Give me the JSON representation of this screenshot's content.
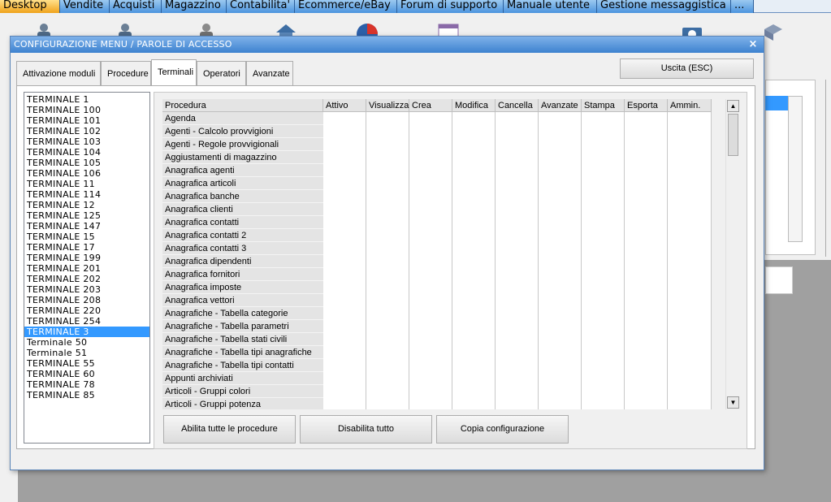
{
  "top_tabs": [
    {
      "label": "Desktop",
      "active": true
    },
    {
      "label": "Vendite"
    },
    {
      "label": "Acquisti"
    },
    {
      "label": "Magazzino"
    },
    {
      "label": "Contabilita'"
    },
    {
      "label": "Ecommerce/eBay"
    },
    {
      "label": "Forum di supporto"
    },
    {
      "label": "Manuale utente"
    },
    {
      "label": "Gestione messaggistica"
    },
    {
      "label": "..."
    }
  ],
  "dialog": {
    "title": "CONFIGURAZIONE MENU / PAROLE DI ACCESSO",
    "close_glyph": "×",
    "tabs": [
      "Attivazione moduli",
      "Procedure",
      "Terminali",
      "Operatori",
      "Avanzate"
    ],
    "active_tab": "Terminali",
    "exit_label": "Uscita (ESC)"
  },
  "terminals": [
    "TERMINALE 1",
    "TERMINALE 100",
    "TERMINALE 101",
    "TERMINALE 102",
    "TERMINALE 103",
    "TERMINALE 104",
    "TERMINALE 105",
    "TERMINALE 106",
    "TERMINALE 11",
    "TERMINALE 114",
    "TERMINALE 12",
    "TERMINALE 125",
    "TERMINALE 147",
    "TERMINALE 15",
    "TERMINALE 17",
    "TERMINALE 199",
    "TERMINALE 201",
    "TERMINALE 202",
    "TERMINALE 203",
    "TERMINALE 208",
    "TERMINALE 220",
    "TERMINALE 254",
    "TERMINALE 3",
    "Terminale 50",
    "Terminale 51",
    "TERMINALE 55",
    "TERMINALE 60",
    "TERMINALE 78",
    "TERMINALE 85"
  ],
  "selected_terminal": "TERMINALE 3",
  "grid": {
    "columns": [
      "Procedura",
      "Attivo",
      "Visualizza",
      "Crea",
      "Modifica",
      "Cancella",
      "Avanzate",
      "Stampa",
      "Esporta",
      "Ammin."
    ],
    "rows": [
      "Agenda",
      "Agenti - Calcolo provvigioni",
      "Agenti - Regole provvigionali",
      "Aggiustamenti di magazzino",
      "Anagrafica agenti",
      "Anagrafica articoli",
      "Anagrafica banche",
      "Anagrafica clienti",
      "Anagrafica contatti",
      "Anagrafica contatti 2",
      "Anagrafica contatti 3",
      "Anagrafica dipendenti",
      "Anagrafica fornitori",
      "Anagrafica imposte",
      "Anagrafica vettori",
      "Anagrafiche - Tabella categorie",
      "Anagrafiche - Tabella parametri",
      "Anagrafiche - Tabella stati civili",
      "Anagrafiche - Tabella tipi anagrafiche",
      "Anagrafiche - Tabella tipi contatti",
      "Appunti archiviati",
      "Articoli - Gruppi colori",
      "Articoli - Gruppi potenza"
    ]
  },
  "scrollbar": {
    "up": "▲",
    "down": "▼"
  },
  "buttons": {
    "enable_all": "Abilita tutte le procedure",
    "disable_all": "Disabilita tutto",
    "copy_config": "Copia configurazione"
  },
  "colors": {
    "selection": "#3399ff",
    "title_bar": "#3d82cf",
    "active_top_tab": "#f0a21a",
    "top_tab": "#4c94de"
  }
}
